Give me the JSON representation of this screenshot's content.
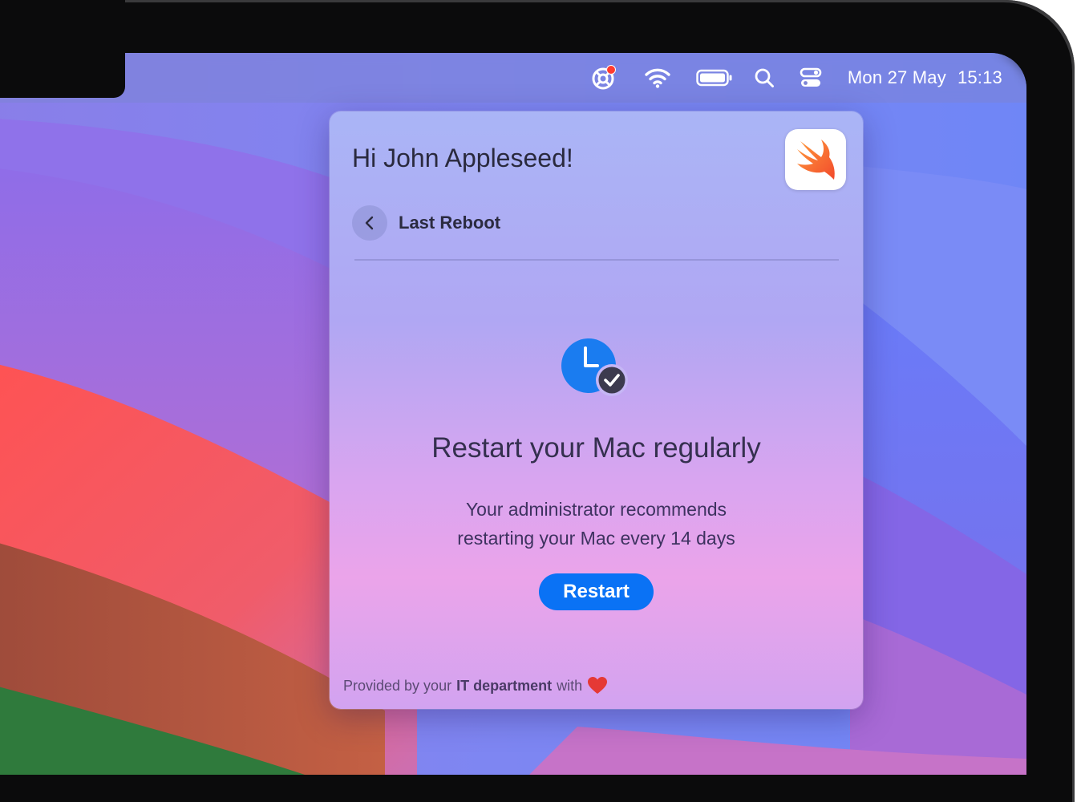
{
  "menubar": {
    "icons": [
      "lifebuoy-icon",
      "wifi-icon",
      "battery-icon",
      "search-icon",
      "control-center-icon"
    ],
    "date": "Mon 27 May",
    "time": "15:13",
    "notification_dot_color": "#ff3b30"
  },
  "panel": {
    "greeting": "Hi John Appleseed!",
    "app_icon": "swift-icon",
    "back_icon": "chevron-left-icon",
    "section_title": "Last Reboot",
    "status_icon": "clock-checkmark-icon",
    "headline": "Restart your Mac regularly",
    "description_line1": "Your administrator recommends",
    "description_line2": "restarting your Mac every 14 days",
    "restart_label": "Restart",
    "footer_prefix": "Provided by your",
    "footer_bold": "IT department",
    "footer_suffix": "with",
    "footer_icon": "heart-icon"
  },
  "colors": {
    "accent": "#0a72f5",
    "clock_blue": "#1a7cf0",
    "heart": "#e53935"
  }
}
